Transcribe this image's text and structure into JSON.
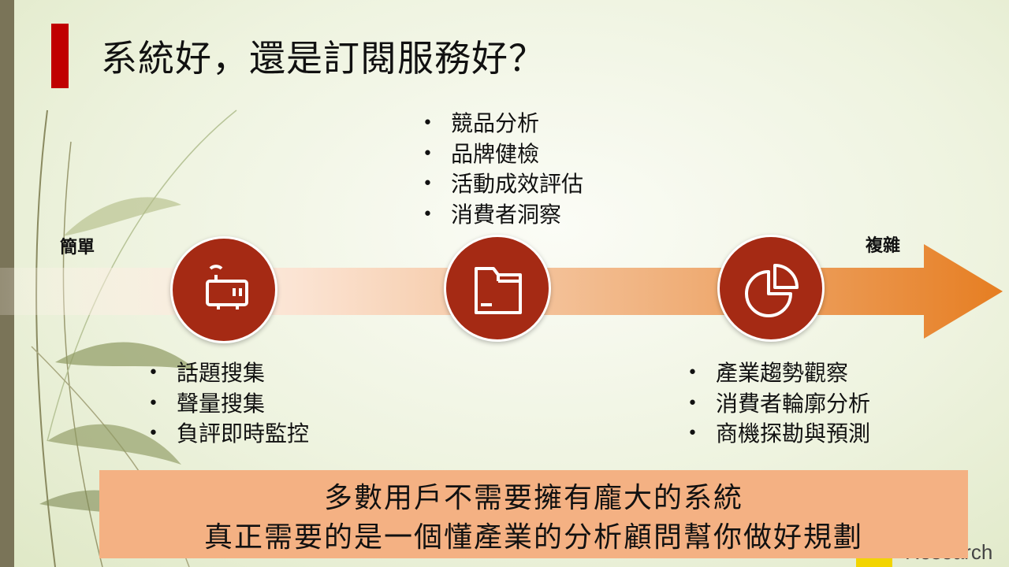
{
  "slide": {
    "title": "系統好，還是訂閱服務好？",
    "axis": {
      "left_label": "簡單",
      "right_label": "複雜"
    },
    "stages": [
      {
        "icon": "router-icon"
      },
      {
        "icon": "folder-icon"
      },
      {
        "icon": "pie-chart-icon"
      }
    ],
    "lists": {
      "top": [
        "競品分析",
        "品牌健檢",
        "活動成效評估",
        "消費者洞察"
      ],
      "left": [
        "話題搜集",
        "聲量搜集",
        "負評即時監控"
      ],
      "right": [
        "產業趨勢觀察",
        "消費者輪廓分析",
        "商機探勘與預測"
      ]
    },
    "callout": {
      "line1": "多數用戶不需要擁有龐大的系統",
      "line2": "真正需要的是一個懂產業的分析顧問幫你做好規劃"
    },
    "logo_text": "Research",
    "colors": {
      "accent_red": "#c00000",
      "circle": "#a52a14",
      "arrow_end": "#e67e22",
      "callout_bg": "#f4b183"
    }
  }
}
